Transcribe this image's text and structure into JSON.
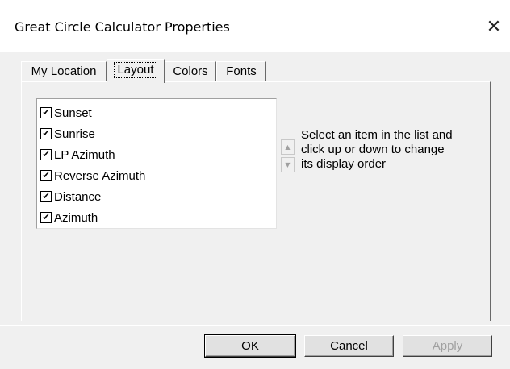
{
  "window": {
    "title": "Great Circle Calculator Properties",
    "close_glyph": "✕"
  },
  "tabs": [
    {
      "label": "My Location",
      "active": false
    },
    {
      "label": "Layout",
      "active": true
    },
    {
      "label": "Colors",
      "active": false
    },
    {
      "label": "Fonts",
      "active": false
    }
  ],
  "layout_panel": {
    "items": [
      {
        "label": "Sunset",
        "checked": true
      },
      {
        "label": "Sunrise",
        "checked": true
      },
      {
        "label": "LP Azimuth",
        "checked": true
      },
      {
        "label": "Reverse Azimuth",
        "checked": true
      },
      {
        "label": "Distance",
        "checked": true
      },
      {
        "label": "Azimuth",
        "checked": true
      }
    ],
    "check_glyph": "✔",
    "up_glyph": "▲",
    "down_glyph": "▼",
    "hint_lines": [
      "Select an item in the list and",
      "click up or down to change",
      "its display order"
    ]
  },
  "buttons": {
    "ok": "OK",
    "cancel": "Cancel",
    "apply": "Apply"
  }
}
